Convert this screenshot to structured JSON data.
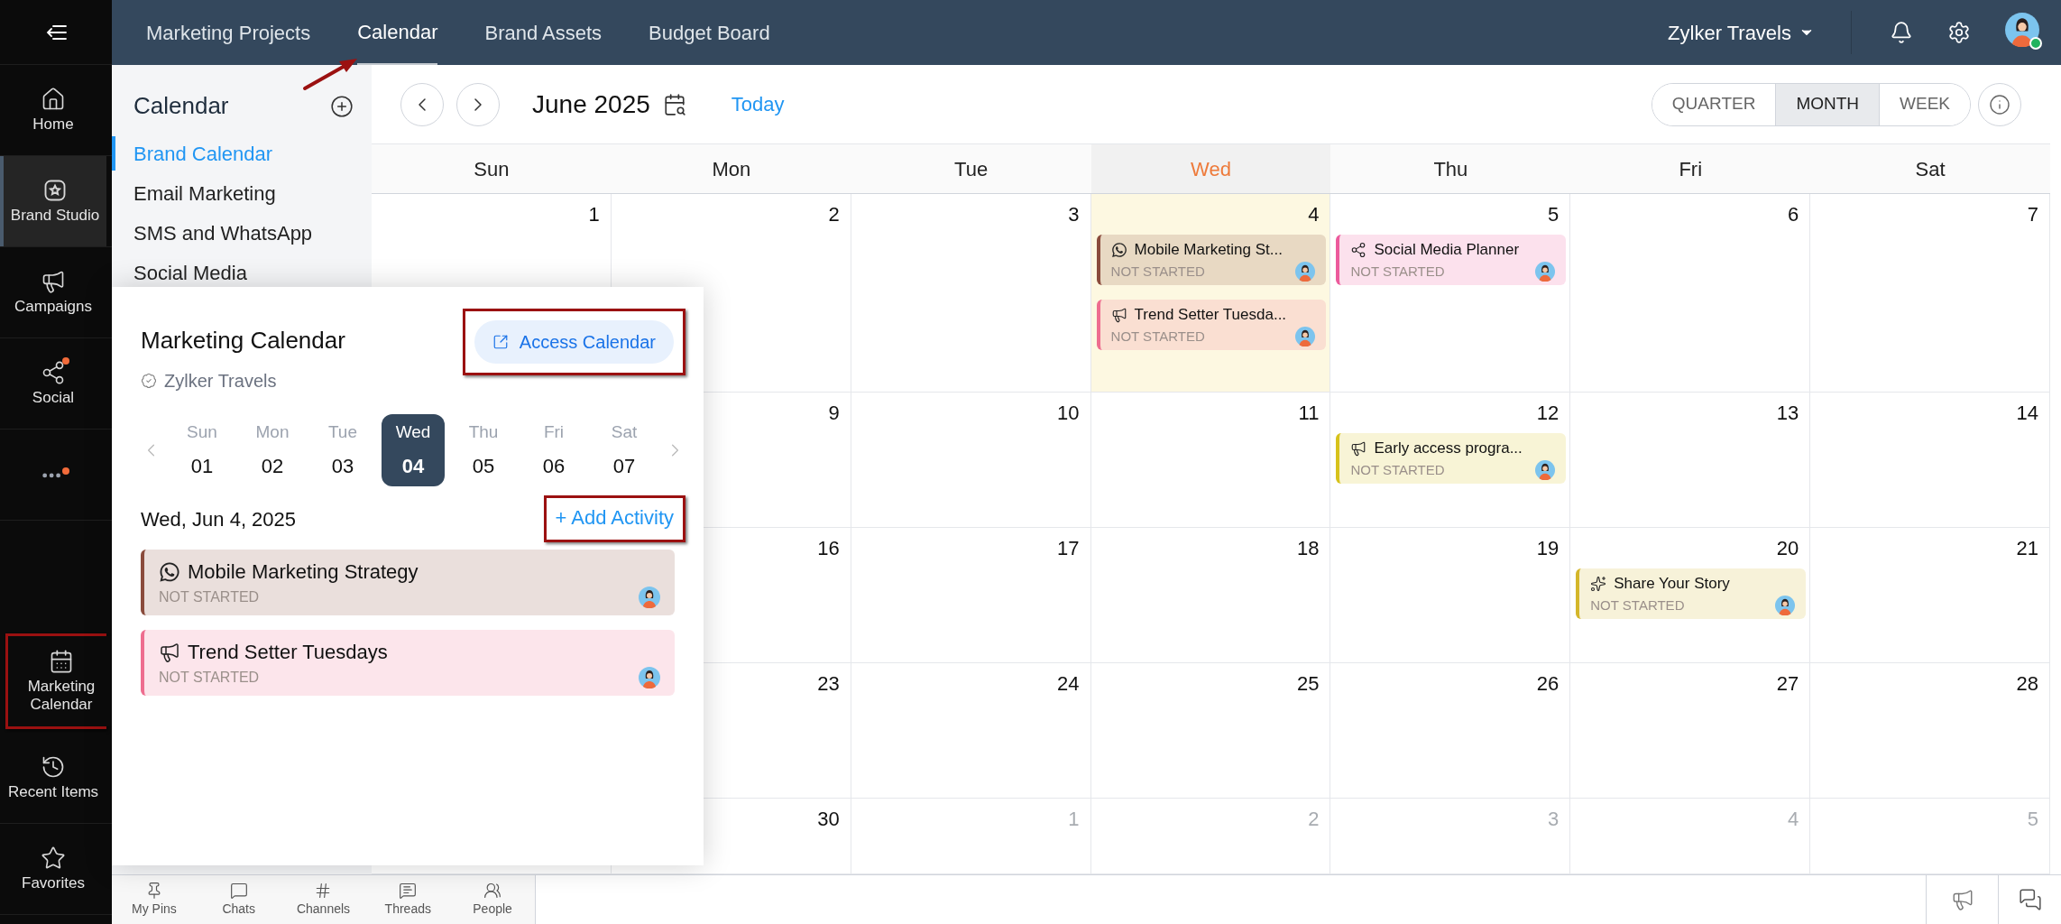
{
  "rail": {
    "items": [
      {
        "kind": "home",
        "label": "Home",
        "selected": false,
        "badge": false,
        "highlighted": false
      },
      {
        "kind": "studio",
        "label": "Brand Studio",
        "selected": true,
        "badge": false,
        "highlighted": false
      },
      {
        "kind": "campaigns",
        "label": "Campaigns",
        "selected": false,
        "badge": false,
        "highlighted": false
      },
      {
        "kind": "social",
        "label": "Social",
        "selected": false,
        "badge": true,
        "highlighted": false
      },
      {
        "kind": "more",
        "selected": false,
        "badge": true,
        "highlighted": false
      },
      {
        "kind": "calendar",
        "label": "Marketing Calendar",
        "selected": false,
        "badge": false,
        "highlighted": true
      },
      {
        "kind": "recent",
        "label": "Recent Items",
        "selected": false,
        "badge": false,
        "highlighted": false
      },
      {
        "kind": "favorites",
        "label": "Favorites",
        "selected": false,
        "badge": false,
        "highlighted": false
      }
    ]
  },
  "top_bar": {
    "tabs": [
      {
        "label": "Marketing Projects",
        "selected": false,
        "pointer_arrow": false
      },
      {
        "label": "Calendar",
        "selected": true,
        "pointer_arrow": true
      },
      {
        "label": "Brand Assets",
        "selected": false,
        "pointer_arrow": false
      },
      {
        "label": "Budget Board",
        "selected": false,
        "pointer_arrow": false
      }
    ],
    "org": "Zylker Travels",
    "online": true
  },
  "sidebar": {
    "title": "Calendar",
    "items": [
      {
        "label": "Brand Calendar",
        "selected": true
      },
      {
        "label": "Email Marketing",
        "selected": false
      },
      {
        "label": "SMS and WhatsApp",
        "selected": false
      },
      {
        "label": "Social Media",
        "selected": false
      }
    ]
  },
  "toolbar": {
    "month": "June 2025",
    "today": "Today",
    "views": [
      {
        "label": "QUARTER",
        "selected": false
      },
      {
        "label": "MONTH",
        "selected": true
      },
      {
        "label": "WEEK",
        "selected": false
      }
    ]
  },
  "calendar": {
    "weekdays": [
      {
        "label": "Sun",
        "today": false
      },
      {
        "label": "Mon",
        "today": false
      },
      {
        "label": "Tue",
        "today": false
      },
      {
        "label": "Wed",
        "today": true
      },
      {
        "label": "Thu",
        "today": false
      },
      {
        "label": "Fri",
        "today": false
      },
      {
        "label": "Sat",
        "today": false
      }
    ],
    "weeks": [
      [
        {
          "date": "1",
          "muted": false,
          "today": false
        },
        {
          "date": "2",
          "muted": false,
          "today": false
        },
        {
          "date": "3",
          "muted": false,
          "today": false
        },
        {
          "date": "4",
          "muted": false,
          "today": true,
          "events": [
            {
              "kind": "whatsapp",
              "title": "Mobile Marketing St...",
              "status": "NOT STARTED",
              "color": "#8a4b3c"
            },
            {
              "kind": "megaphone",
              "title": "Trend Setter Tuesda...",
              "status": "NOT STARTED",
              "color": "#ee6d8f"
            }
          ]
        },
        {
          "date": "5",
          "muted": false,
          "today": false,
          "events": [
            {
              "kind": "share",
              "title": "Social Media Planner",
              "status": "NOT STARTED",
              "color": "#ec5a9c"
            }
          ]
        },
        {
          "date": "6",
          "muted": false,
          "today": false
        },
        {
          "date": "7",
          "muted": false,
          "today": false
        }
      ],
      [
        {
          "date": "9",
          "muted": false,
          "today": false
        },
        {
          "date": "10",
          "muted": false,
          "today": false
        },
        {
          "date": "11",
          "muted": false,
          "today": false
        },
        {
          "date": "12",
          "muted": false,
          "today": false,
          "events": [
            {
              "kind": "megaphone",
              "title": "Early access progra...",
              "status": "NOT STARTED",
              "color": "#d7c21b"
            }
          ]
        },
        {
          "date": "13",
          "muted": false,
          "today": false
        },
        {
          "date": "14",
          "muted": false,
          "today": false
        }
      ],
      [
        {
          "date": "16",
          "muted": false,
          "today": false
        },
        {
          "date": "17",
          "muted": false,
          "today": false
        },
        {
          "date": "18",
          "muted": false,
          "today": false
        },
        {
          "date": "19",
          "muted": false,
          "today": false
        },
        {
          "date": "20",
          "muted": false,
          "today": false,
          "events": [
            {
              "kind": "sparkles",
              "title": "Share Your Story",
              "status": "NOT STARTED",
              "color": "#d4b62a"
            }
          ]
        },
        {
          "date": "21",
          "muted": false,
          "today": false
        }
      ],
      [
        {
          "date": "23",
          "muted": false,
          "today": false
        },
        {
          "date": "24",
          "muted": false,
          "today": false
        },
        {
          "date": "25",
          "muted": false,
          "today": false
        },
        {
          "date": "26",
          "muted": false,
          "today": false
        },
        {
          "date": "27",
          "muted": false,
          "today": false
        },
        {
          "date": "28",
          "muted": false,
          "today": false
        }
      ],
      [
        {
          "date": "30",
          "muted": false,
          "today": false
        },
        {
          "date": "1",
          "muted": true,
          "today": false
        },
        {
          "date": "2",
          "muted": true,
          "today": false
        },
        {
          "date": "3",
          "muted": true,
          "today": false
        },
        {
          "date": "4",
          "muted": true,
          "today": false
        },
        {
          "date": "5",
          "muted": true,
          "today": false
        }
      ]
    ]
  },
  "popup": {
    "title": "Marketing Calendar",
    "org": "Zylker Travels",
    "access_button": {
      "label": "Access Calendar",
      "highlighted": true
    },
    "days": [
      {
        "weekday": "Sun",
        "day": "01",
        "selected": false
      },
      {
        "weekday": "Mon",
        "day": "02",
        "selected": false
      },
      {
        "weekday": "Tue",
        "day": "03",
        "selected": false
      },
      {
        "weekday": "Wed",
        "day": "04",
        "selected": true
      },
      {
        "weekday": "Thu",
        "day": "05",
        "selected": false
      },
      {
        "weekday": "Fri",
        "day": "06",
        "selected": false
      },
      {
        "weekday": "Sat",
        "day": "07",
        "selected": false
      }
    ],
    "date_heading": "Wed, Jun 4, 2025",
    "add_activity": {
      "label": "+ Add Activity",
      "highlighted": true
    },
    "activities": [
      {
        "kind": "whatsapp",
        "title": "Mobile Marketing Strategy",
        "status": "NOT STARTED",
        "color": "#8a4b3c"
      },
      {
        "kind": "megaphone",
        "title": "Trend Setter Tuesdays",
        "status": "NOT STARTED",
        "color": "#ee6d8f"
      }
    ]
  },
  "bottom_bar": {
    "items": [
      {
        "kind": "pin",
        "label": "My Pins"
      },
      {
        "kind": "chats",
        "label": "Chats"
      },
      {
        "kind": "channels",
        "label": "Channels"
      },
      {
        "kind": "threads",
        "label": "Threads"
      },
      {
        "kind": "people",
        "label": "People"
      }
    ]
  }
}
